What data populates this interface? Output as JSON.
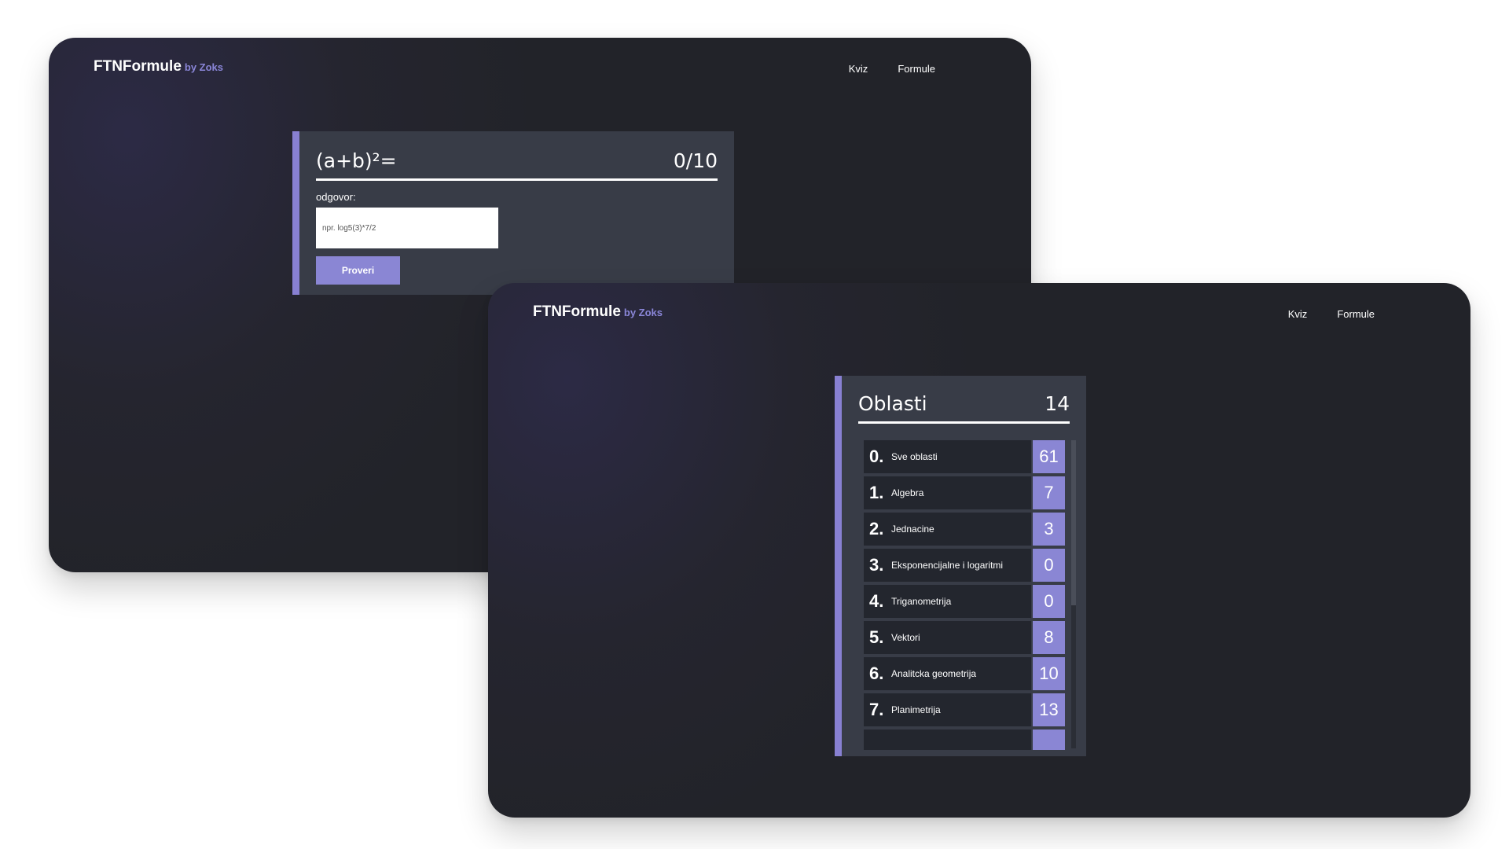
{
  "brand": {
    "name": "FTNFormule",
    "by": "by Zoks"
  },
  "nav": {
    "quiz": "Kviz",
    "formulas": "Formule"
  },
  "quiz": {
    "question": "(a+b)²=",
    "score": "0/10",
    "answer_label": "odgovor:",
    "answer_placeholder": "npr. log5(3)*7/2",
    "check_button": "Proveri"
  },
  "areas": {
    "title": "Oblasti",
    "total": "14",
    "items": [
      {
        "num": "0.",
        "name": "Sve oblasti",
        "count": "61"
      },
      {
        "num": "1.",
        "name": "Algebra",
        "count": "7"
      },
      {
        "num": "2.",
        "name": "Jednacine",
        "count": "3"
      },
      {
        "num": "3.",
        "name": "Eksponencijalne i logaritmi",
        "count": "0"
      },
      {
        "num": "4.",
        "name": "Triganometrija",
        "count": "0"
      },
      {
        "num": "5.",
        "name": "Vektori",
        "count": "8"
      },
      {
        "num": "6.",
        "name": "Analitcka geometrija",
        "count": "10"
      },
      {
        "num": "7.",
        "name": "Planimetrija",
        "count": "13"
      },
      {
        "num": "",
        "name": "",
        "count": ""
      }
    ]
  },
  "colors": {
    "accent": "#8a86d4",
    "card": "#383c47",
    "background": "#25252f"
  }
}
